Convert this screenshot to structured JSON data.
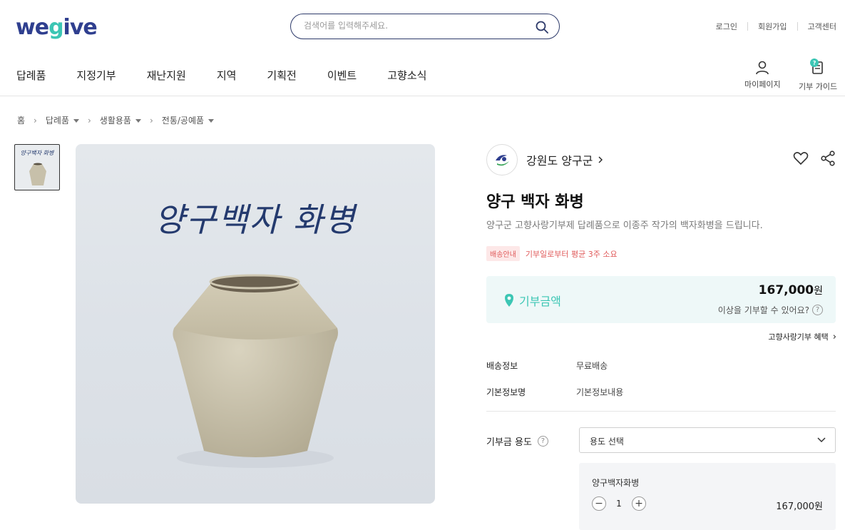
{
  "header": {
    "logo_pre": "we",
    "logo_mid": "g",
    "logo_post": "ive",
    "search_placeholder": "검색어를 입력해주세요.",
    "util": [
      "로그인",
      "회원가입",
      "고객센터"
    ],
    "nav": [
      "답례품",
      "지정기부",
      "재난지원",
      "지역",
      "기획전",
      "이벤트",
      "고향소식"
    ],
    "mypage": "마이페이지",
    "guide": "기부 가이드",
    "guide_badge": "?"
  },
  "breadcrumb": {
    "home": "홈",
    "items": [
      "답례품",
      "생활용품",
      "전통/공예품"
    ]
  },
  "product": {
    "thumb_caption": "양구백자 화병",
    "image_caption": "양구백자 화병",
    "seller": "강원도 양구군",
    "title": "양구 백자 화병",
    "description": "양구군 고향사랑기부제 답례품으로 이종주 작가의 백자화병을 드립니다.",
    "ship_tag": "배송안내",
    "ship_text": "기부일로부터 평균 3주 소요",
    "price_label": "기부금액",
    "price_value": "167,000",
    "price_unit": "원",
    "price_more": "이상을 기부할 수 있어요?",
    "benefit": "고향사랑기부 혜택",
    "info": [
      {
        "label": "배송정보",
        "value": "무료배송"
      },
      {
        "label": "기본정보명",
        "value": "기본정보내용"
      }
    ],
    "usage_label": "기부금 용도",
    "usage_select": "용도 선택",
    "option": {
      "name": "양구백자화병",
      "qty": "1",
      "price": "167,000원"
    }
  },
  "colors": {
    "brand_navy": "#2f3f8f",
    "brand_mint": "#3cc6b4",
    "ship_red": "#e05b5b",
    "price_bg": "#eef8f8"
  }
}
